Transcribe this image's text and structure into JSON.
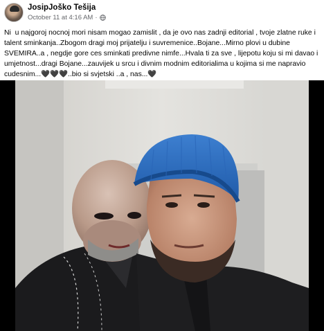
{
  "post": {
    "author_name": "JosipJoško Tešija",
    "timestamp": "October 11 at 4:16 AM",
    "separator": "·",
    "privacy_icon": "globe-icon",
    "body_text": "Ni  u najgoroj nocnoj mori nisam mogao zamislit , da je ovo nas zadnji editorial , tvoje zlatne ruke i talent sminkanja..Zbogom dragi moj prijatelju i suvremenice..Bojane...Mirno plovi u dubine SVEMIRA..a , negdje gore ces sminkati predivne nimfe...Hvala ti za sve , lijepotu koju si mi davao i umjetnost...dragi Bojane...zauvijek u srcu i divnim modnim editorialima u kojima si me napravio cudesnim...🖤🖤🖤..bio si svjetski ..a , nas...🖤",
    "image_description_icon": "photo"
  }
}
